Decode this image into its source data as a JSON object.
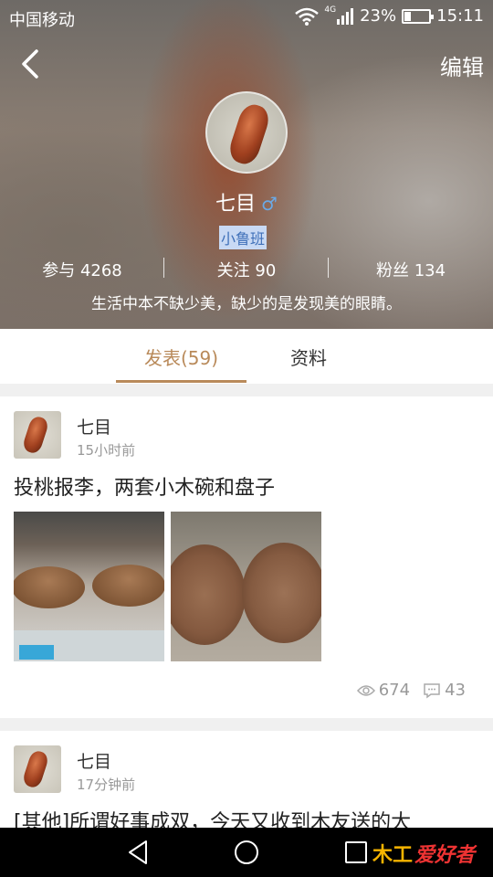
{
  "status_bar": {
    "carrier": "中国移动",
    "network": "4G",
    "battery": "23%",
    "time": "15:11"
  },
  "header": {
    "back_icon": "chevron-left-icon",
    "edit_label": "编辑"
  },
  "profile": {
    "name": "七目",
    "gender_symbol": "♂",
    "badge": "小鲁班",
    "stats": [
      {
        "label": "参与",
        "value": "4268"
      },
      {
        "label": "关注",
        "value": "90"
      },
      {
        "label": "粉丝",
        "value": "134"
      }
    ],
    "motto": "生活中本不缺少美，缺少的是发现美的眼睛。"
  },
  "tabs": [
    {
      "label": "发表(59)",
      "active": true
    },
    {
      "label": "资料",
      "active": false
    }
  ],
  "posts": [
    {
      "author": "七目",
      "time": "15小时前",
      "title": "投桃报李，两套小木碗和盘子",
      "views": "674",
      "comments": "43"
    },
    {
      "author": "七目",
      "time": "17分钟前",
      "title": "[其他]所谓好事成双，今天又收到木友送的大"
    }
  ],
  "nav": {
    "logo_mark": "木工",
    "logo_text": "爱好者"
  },
  "colors": {
    "accent": "#b98a5a",
    "gender": "#6aa9e6",
    "badge_bg": "#c8d9f4"
  }
}
